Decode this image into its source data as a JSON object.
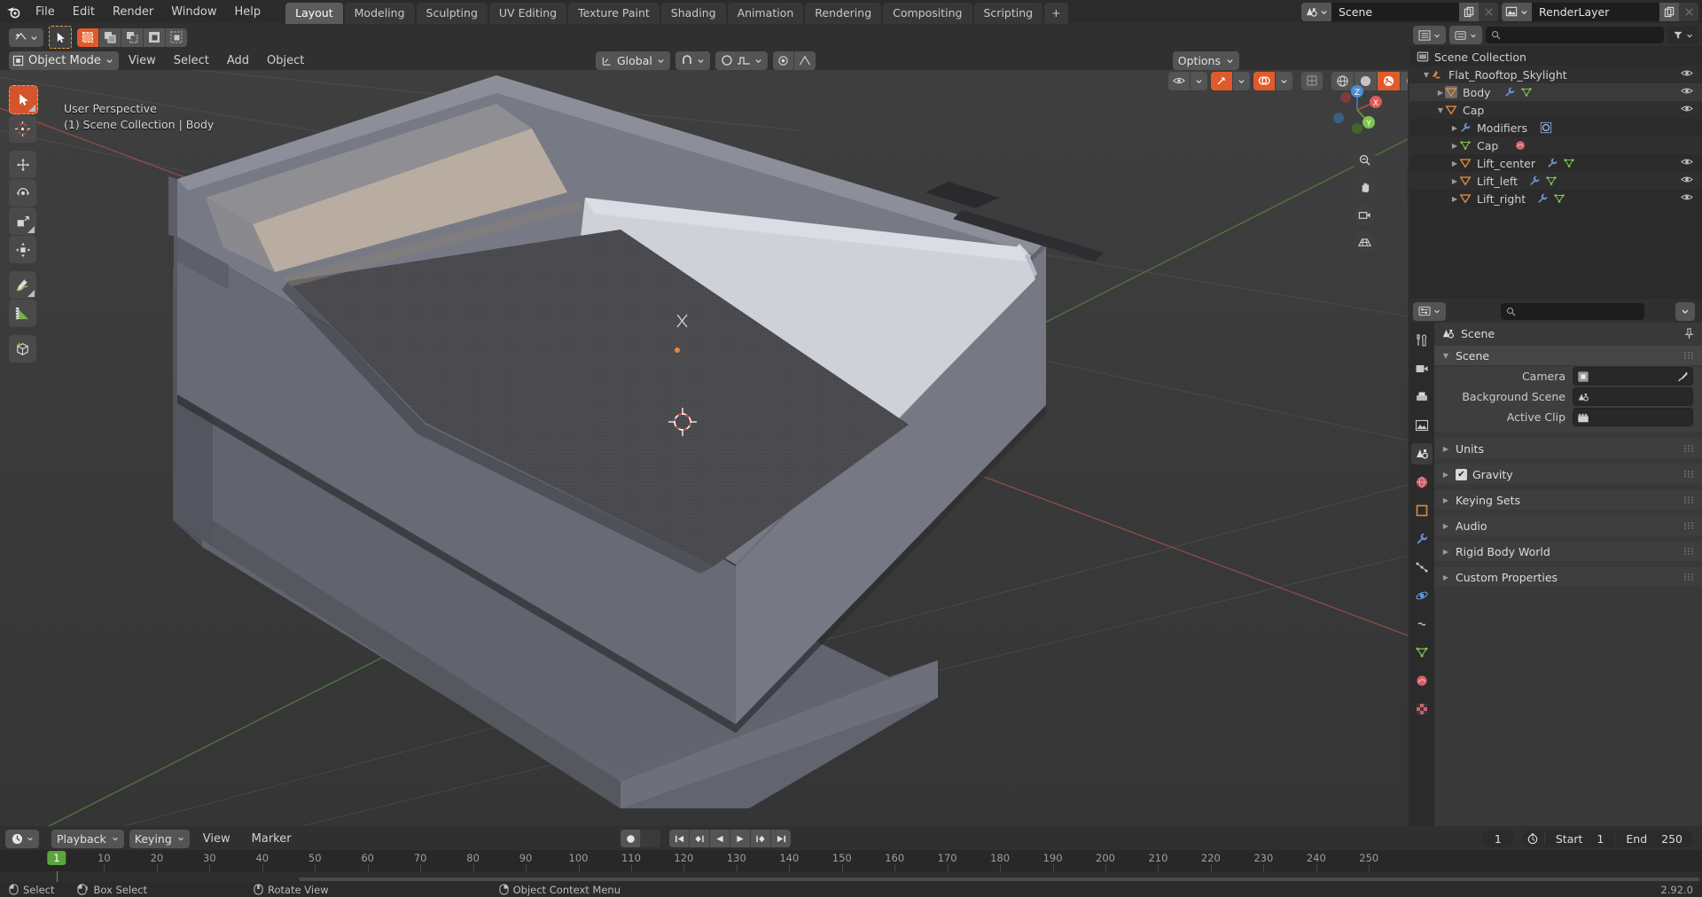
{
  "app": {
    "version": "2.92.0",
    "accent_orange": "#e05a2b",
    "accent_green": "#5ca53c",
    "accent_blue": "#4772b3"
  },
  "topbar": {
    "logo_icon": "blender-logo-icon",
    "menus": [
      "File",
      "Edit",
      "Render",
      "Window",
      "Help"
    ],
    "workspace_tabs": [
      {
        "label": "Layout",
        "active": true
      },
      {
        "label": "Modeling",
        "active": false
      },
      {
        "label": "Sculpting",
        "active": false
      },
      {
        "label": "UV Editing",
        "active": false
      },
      {
        "label": "Texture Paint",
        "active": false
      },
      {
        "label": "Shading",
        "active": false
      },
      {
        "label": "Animation",
        "active": false
      },
      {
        "label": "Rendering",
        "active": false
      },
      {
        "label": "Compositing",
        "active": false
      },
      {
        "label": "Scripting",
        "active": false
      }
    ],
    "add_workspace_label": "+",
    "scene": {
      "icon": "scene-icon",
      "name": "Scene",
      "copy_icon": "new-scene-icon",
      "unlink_icon": "unlink-icon"
    },
    "viewlayer": {
      "icon": "viewlayer-icon",
      "name": "RenderLayer",
      "copy_icon": "new-viewlayer-icon",
      "unlink_icon": "unlink-icon"
    }
  },
  "viewport": {
    "header": {
      "editor_type_icon": "editor-type-3dview-icon",
      "tool_cursor_icon": "tweak-tool-icon",
      "select_modes": [
        "set",
        "extend",
        "subtract",
        "invert",
        "intersect"
      ],
      "mode": "Object Mode",
      "mode_icon": "object-mode-icon",
      "menus": [
        "View",
        "Select",
        "Add",
        "Object"
      ],
      "transform_orientation": "Global",
      "orientation_icon": "orientation-global-icon",
      "snap_icon": "magnet-icon",
      "proportional_icon": "proportional-edit-icon",
      "falloff_icon": "falloff-smooth-icon",
      "options_label": "Options",
      "visibility_icon": "visibility-eye-icon",
      "gizmo_icon": "gizmo-icon",
      "overlays_icon": "overlays-icon",
      "xray_icon": "xray-icon",
      "shading_modes": [
        "wireframe",
        "solid",
        "material-preview",
        "rendered"
      ],
      "shading_active": "material-preview"
    },
    "overlay_text": {
      "perspective": "User Perspective",
      "collection_object": "(1) Scene Collection | Body"
    },
    "toolbar": [
      {
        "name": "tweak-select-tool",
        "icon": "cursor-arrow-icon",
        "active": true
      },
      {
        "name": "cursor-tool",
        "icon": "3d-cursor-icon",
        "active": false
      },
      {
        "name": "move-tool",
        "icon": "move-arrows-icon",
        "active": false
      },
      {
        "name": "rotate-tool",
        "icon": "rotate-icon",
        "active": false
      },
      {
        "name": "scale-tool",
        "icon": "scale-icon",
        "active": false
      },
      {
        "name": "transform-tool",
        "icon": "transform-icon",
        "active": false
      },
      {
        "name": "annotate-tool",
        "icon": "pencil-icon",
        "active": false
      },
      {
        "name": "measure-tool",
        "icon": "ruler-icon",
        "active": false
      },
      {
        "name": "add-cube-tool",
        "icon": "add-cube-icon",
        "active": false
      }
    ],
    "nav_gizmo": {
      "axes": [
        "X",
        "Y",
        "Z"
      ],
      "x_color": "#e05a5a",
      "y_color": "#7fc44f",
      "z_color": "#4b8ed6"
    },
    "nav_buttons": [
      {
        "name": "zoom-view-button",
        "icon": "magnifier-icon"
      },
      {
        "name": "pan-view-button",
        "icon": "hand-icon"
      },
      {
        "name": "camera-view-button",
        "icon": "camera-icon"
      },
      {
        "name": "toggle-perspective-button",
        "icon": "grid-persp-icon"
      }
    ]
  },
  "outliner": {
    "header": {
      "editor_type_icon": "editor-type-outliner-icon",
      "display_mode_icon": "outliner-display-mode-icon",
      "filter_icon": "filter-icon",
      "search_placeholder": ""
    },
    "rows": [
      {
        "label": "Scene Collection",
        "indent": 0,
        "icon": "collection-icon",
        "expander": "",
        "eye": false,
        "extra_icons": []
      },
      {
        "label": "Flat_Rooftop_Skylight",
        "indent": 1,
        "icon": "collection-orange-icon",
        "expander": "down",
        "eye": true,
        "extra_icons": []
      },
      {
        "label": "Body",
        "indent": 2,
        "icon": "mesh-object-icon",
        "expander": "right",
        "eye": true,
        "extra_icons": [
          "modifier-wrench-icon",
          "mesh-data-icon"
        ],
        "selected": true
      },
      {
        "label": "Cap",
        "indent": 2,
        "icon": "mesh-object-icon",
        "expander": "down",
        "eye": true,
        "extra_icons": []
      },
      {
        "label": "Modifiers",
        "indent": 3,
        "icon": "modifier-wrench-icon",
        "expander": "right",
        "eye": false,
        "extra_icons": [
          "solidify-modifier-icon"
        ]
      },
      {
        "label": "Cap",
        "indent": 3,
        "icon": "mesh-data-icon",
        "expander": "right",
        "eye": false,
        "extra_icons": [
          "material-icon"
        ]
      },
      {
        "label": "Lift_center",
        "indent": 3,
        "icon": "mesh-object-icon",
        "expander": "right",
        "eye": true,
        "extra_icons": [
          "modifier-wrench-icon",
          "mesh-data-icon"
        ]
      },
      {
        "label": "Lift_left",
        "indent": 3,
        "icon": "mesh-object-icon",
        "expander": "right",
        "eye": true,
        "extra_icons": [
          "modifier-wrench-icon",
          "mesh-data-icon"
        ]
      },
      {
        "label": "Lift_right",
        "indent": 3,
        "icon": "mesh-object-icon",
        "expander": "right",
        "eye": true,
        "extra_icons": [
          "modifier-wrench-icon",
          "mesh-data-icon"
        ]
      }
    ]
  },
  "properties": {
    "header": {
      "editor_type_icon": "editor-type-properties-icon",
      "search_placeholder": "",
      "filter_icon": "chevron-down-icon"
    },
    "tabs": [
      {
        "name": "tool",
        "icon": "tool-wrench-screwdriver-icon",
        "active": false
      },
      {
        "name": "render",
        "icon": "render-camera-icon",
        "active": false
      },
      {
        "name": "output",
        "icon": "output-printer-icon",
        "active": false
      },
      {
        "name": "view-layer",
        "icon": "viewlayer-images-icon",
        "active": false
      },
      {
        "name": "scene",
        "icon": "scene-cone-icon",
        "active": true
      },
      {
        "name": "world",
        "icon": "world-globe-icon",
        "active": false
      },
      {
        "name": "object",
        "icon": "object-square-icon",
        "active": false
      },
      {
        "name": "modifiers",
        "icon": "modifier-wrench-icon",
        "active": false
      },
      {
        "name": "particles",
        "icon": "particles-icon",
        "active": false
      },
      {
        "name": "physics",
        "icon": "physics-orbit-icon",
        "active": false
      },
      {
        "name": "constraints",
        "icon": "constraints-icon",
        "active": false
      },
      {
        "name": "data",
        "icon": "object-data-icon",
        "active": false
      },
      {
        "name": "material",
        "icon": "material-sphere-icon",
        "active": false
      },
      {
        "name": "texture",
        "icon": "texture-checker-icon",
        "active": false
      }
    ],
    "breadcrumb": {
      "icon": "scene-cone-icon",
      "label": "Scene",
      "pin_icon": "pin-icon"
    },
    "panels": [
      {
        "title": "Scene",
        "open": true,
        "fields": [
          {
            "label": "Camera",
            "value": "",
            "icon": "camera-data-icon",
            "eyedropper": true
          },
          {
            "label": "Background Scene",
            "value": "",
            "icon": "scene-cone-icon",
            "eyedropper": false
          },
          {
            "label": "Active Clip",
            "value": "",
            "icon": "clapperboard-icon",
            "eyedropper": false
          }
        ]
      },
      {
        "title": "Units",
        "open": false,
        "fields": []
      },
      {
        "title": "Gravity",
        "open": false,
        "checkbox": true,
        "checked": true,
        "fields": []
      },
      {
        "title": "Keying Sets",
        "open": false,
        "fields": []
      },
      {
        "title": "Audio",
        "open": false,
        "fields": []
      },
      {
        "title": "Rigid Body World",
        "open": false,
        "fields": []
      },
      {
        "title": "Custom Properties",
        "open": false,
        "fields": []
      }
    ]
  },
  "timeline": {
    "editor_type_icon": "editor-type-timeline-icon",
    "menus": [
      {
        "label": "Playback",
        "dropdown": true
      },
      {
        "label": "Keying",
        "dropdown": true
      },
      {
        "label": "View",
        "dropdown": false
      },
      {
        "label": "Marker",
        "dropdown": false
      }
    ],
    "record_icon": "record-keyframes-icon",
    "transport": [
      {
        "name": "jump-to-start-button",
        "icon": "jump-start-icon"
      },
      {
        "name": "jump-prev-keyframe-button",
        "icon": "prev-keyframe-icon"
      },
      {
        "name": "play-reverse-button",
        "icon": "play-reverse-icon"
      },
      {
        "name": "play-button",
        "icon": "play-icon"
      },
      {
        "name": "jump-next-keyframe-button",
        "icon": "next-keyframe-icon"
      },
      {
        "name": "jump-to-end-button",
        "icon": "jump-end-icon"
      }
    ],
    "current_frame": "1",
    "frame_icon": "stopwatch-icon",
    "start_label": "Start",
    "start_value": "1",
    "end_label": "End",
    "end_value": "250",
    "playhead_frame": 1,
    "ruler_ticks": [
      10,
      20,
      30,
      40,
      50,
      60,
      70,
      80,
      90,
      100,
      110,
      120,
      130,
      140,
      150,
      160,
      170,
      180,
      190,
      200,
      210,
      220,
      230,
      240,
      250
    ]
  },
  "statusbar": {
    "items": [
      {
        "icon": "mouse-left-icon",
        "label": "Select"
      },
      {
        "icon": "mouse-left-drag-icon",
        "label": "Box Select"
      },
      {
        "icon": "mouse-middle-icon",
        "label": "Rotate View"
      },
      {
        "icon": "mouse-right-icon",
        "label": "Object Context Menu"
      }
    ],
    "version": "2.92.0"
  }
}
